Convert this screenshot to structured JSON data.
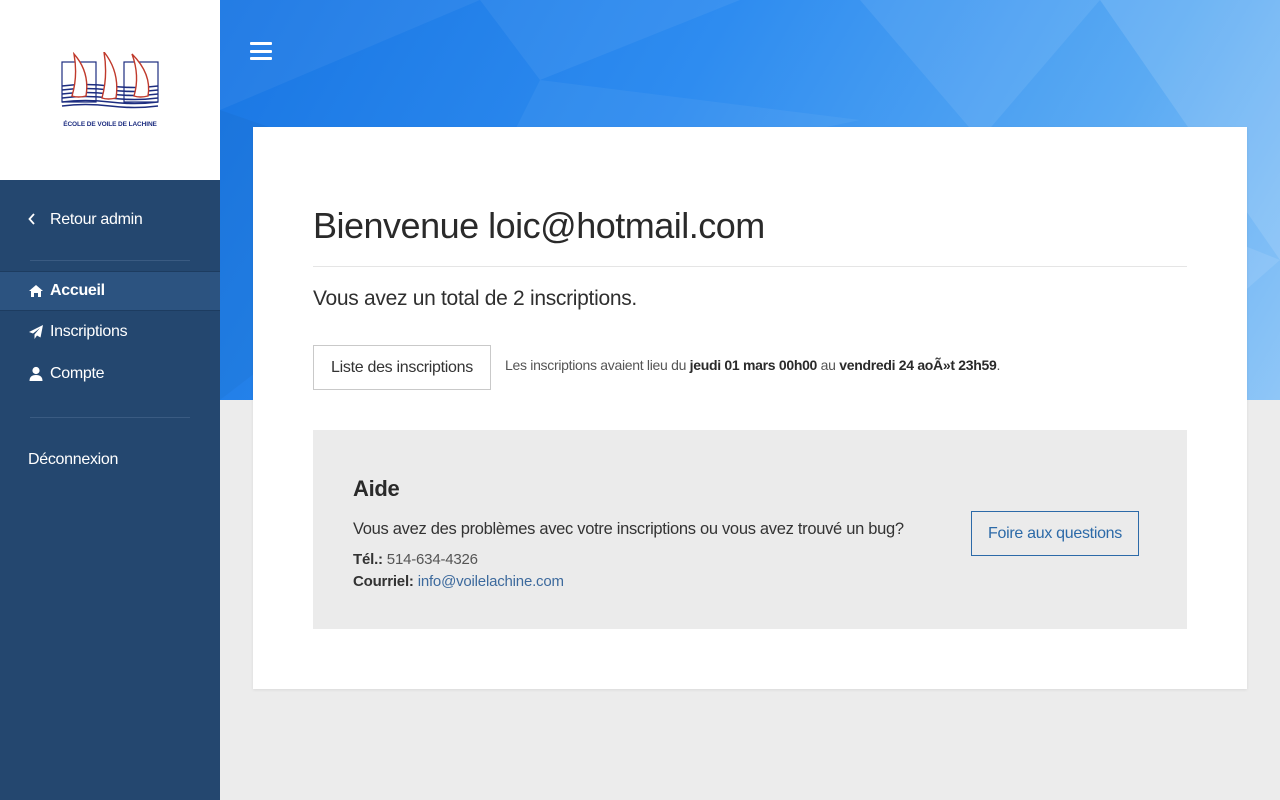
{
  "logo": {
    "text": "ÉCOLE DE VOILE DE LACHINE"
  },
  "sidebar": {
    "back_label": "Retour admin",
    "items": [
      {
        "label": "Accueil",
        "icon": "home-icon",
        "active": true
      },
      {
        "label": "Inscriptions",
        "icon": "paper-plane-icon",
        "active": false
      },
      {
        "label": "Compte",
        "icon": "user-icon",
        "active": false
      }
    ],
    "logout_label": "Déconnexion"
  },
  "main": {
    "title": "Bienvenue loic@hotmail.com",
    "total_text": "Vous avez un total de 2 inscriptions.",
    "list_button": "Liste des inscriptions",
    "dates": {
      "prefix": "Les inscriptions avaient lieu du ",
      "start": "jeudi 01 mars 00h00",
      "middle": " au ",
      "end": "vendredi 24 aoÃ»t 23h59",
      "suffix": "."
    },
    "help": {
      "title": "Aide",
      "text": "Vous avez des problèmes avec votre inscriptions ou vous avez trouvé un bug?",
      "tel_label": "Tél.:",
      "tel_value": " 514-634-4326",
      "mail_label": "Courriel:",
      "mail_value": "info@voilelachine.com",
      "faq_button": "Foire aux questions"
    }
  },
  "colors": {
    "sidebar": "#24476f",
    "sidebar_active": "#2c5380",
    "hero_start": "#1976e3",
    "hero_end": "#8fc6f7",
    "link": "#2c6aa8"
  }
}
